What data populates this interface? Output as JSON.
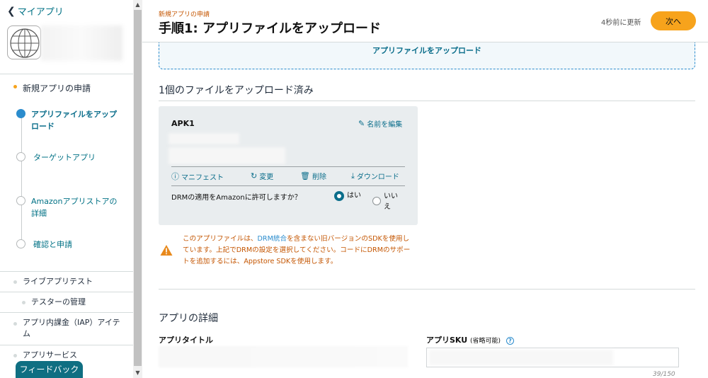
{
  "sidebar": {
    "back_label": "マイアプリ",
    "section_title": "新規アプリの申請",
    "steps": [
      {
        "label": "アプリファイルをアップロード",
        "state": "active"
      },
      {
        "label": "ターゲットアプリ",
        "state": "pending"
      },
      {
        "label": "Amazonアプリストアの詳細",
        "state": "pending"
      },
      {
        "label": "確認と申請",
        "state": "pending"
      }
    ],
    "items": [
      {
        "label": "ライブアプリテスト"
      },
      {
        "label": "テスターの管理"
      },
      {
        "label": "アプリ内課金（IAP）アイテム"
      },
      {
        "label": "アプリサービス"
      }
    ],
    "feedback_label": "フィードバック"
  },
  "header": {
    "breadcrumb": "新規アプリの申請",
    "title": "手順1: アプリファイルをアップロード",
    "updated": "4秒前に更新",
    "next_label": "次へ"
  },
  "upload": {
    "label": "アプリファイルをアップロード"
  },
  "uploaded": {
    "heading": "1個のファイルをアップロード済み",
    "apk": {
      "title": "APK1",
      "rename_label": "名前を編集",
      "actions": {
        "manifest": "マニフェスト",
        "change": "変更",
        "delete": "削除",
        "download": "ダウンロード"
      },
      "drm_question": "DRMの適用をAmazonに許可しますか？",
      "drm_yes": "はい",
      "drm_no": "いいえ",
      "drm_selected": "はい"
    },
    "warning": {
      "part1": "このアプリファイルは、",
      "link": "DRM統合",
      "part2": "を含まない旧バージョンのSDKを使用しています。上記でDRMの設定を選択してください。コードにDRMのサポートを追加するには、Appstore SDKを使用します。"
    }
  },
  "details": {
    "heading": "アプリの詳細",
    "title_label": "アプリタイトル",
    "sku_label": "アプリSKU",
    "sku_optional": "(省略可能)",
    "sku_counter": "39/150"
  },
  "colors": {
    "accent": "#0b6e8b",
    "warning": "#c45500",
    "primary_button": "#f7a31c",
    "feedback": "#0f6f82"
  }
}
